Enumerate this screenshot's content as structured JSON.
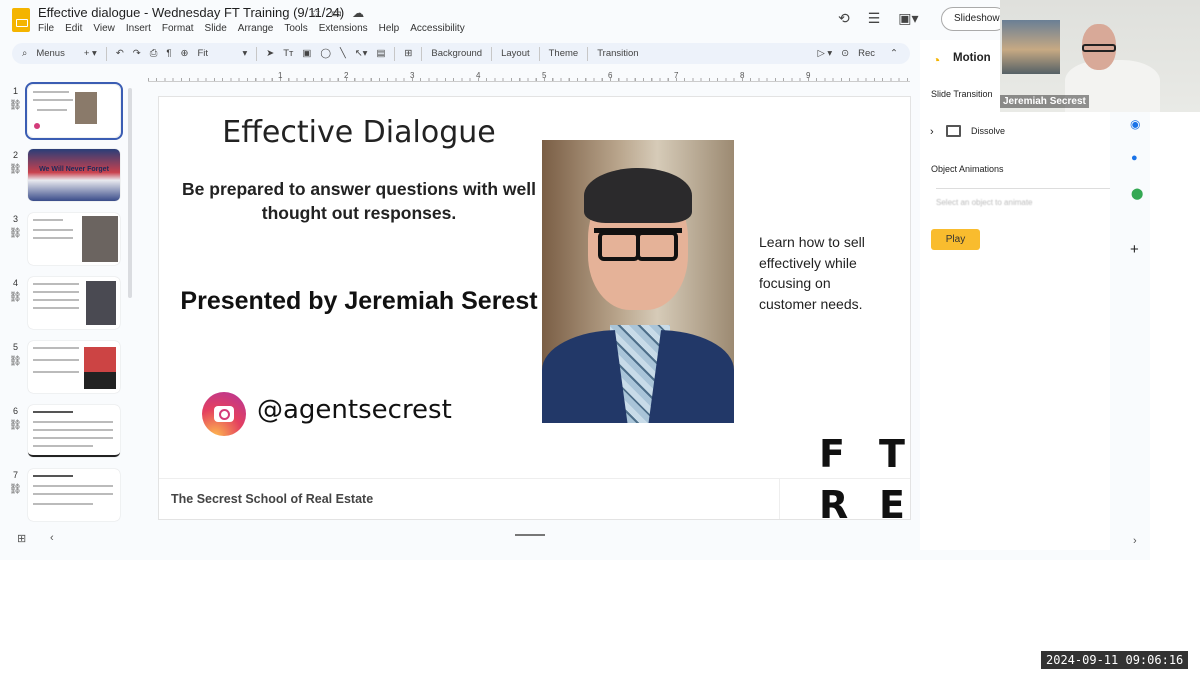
{
  "app": {
    "title": "Effective dialogue - Wednesday FT Training (9/11/24)",
    "menu": [
      "File",
      "Edit",
      "View",
      "Insert",
      "Format",
      "Slide",
      "Arrange",
      "Tools",
      "Extensions",
      "Help",
      "Accessibility"
    ],
    "slideshow_label": "Slideshow"
  },
  "toolbar": {
    "menus_label": "Menus",
    "zoom_value": "Fit",
    "background": "Background",
    "layout": "Layout",
    "theme": "Theme",
    "transition": "Transition",
    "rec": "Rec"
  },
  "ruler": [
    "1",
    "2",
    "3",
    "4",
    "5",
    "6",
    "7",
    "8",
    "9"
  ],
  "thumbnails": [
    {
      "num": "1",
      "text": ""
    },
    {
      "num": "2",
      "text": "We Will Never Forget"
    },
    {
      "num": "3",
      "text": ""
    },
    {
      "num": "4",
      "text": ""
    },
    {
      "num": "5",
      "text": ""
    },
    {
      "num": "6",
      "text": ""
    },
    {
      "num": "7",
      "text": ""
    }
  ],
  "slide": {
    "title": "Effective Dialogue",
    "subtitle": "Be prepared to answer questions with well thought out responses.",
    "presented": "Presented by Jeremiah Serest",
    "handle": "@agentsecrest",
    "side_text": "Learn how to sell effectively while focusing on customer needs.",
    "footer": "The Secrest School of Real Estate",
    "logo_letters": [
      "F",
      "T",
      "R",
      "E"
    ]
  },
  "motion": {
    "title": "Motion",
    "slide_transition": "Slide Transition",
    "transition_value": "Dissolve",
    "object_animations": "Object Animations",
    "placeholder": "Select an object to animate",
    "play": "Play"
  },
  "video": {
    "name": "Jeremiah Secrest"
  },
  "timestamp": "2024-09-11 09:06:16"
}
